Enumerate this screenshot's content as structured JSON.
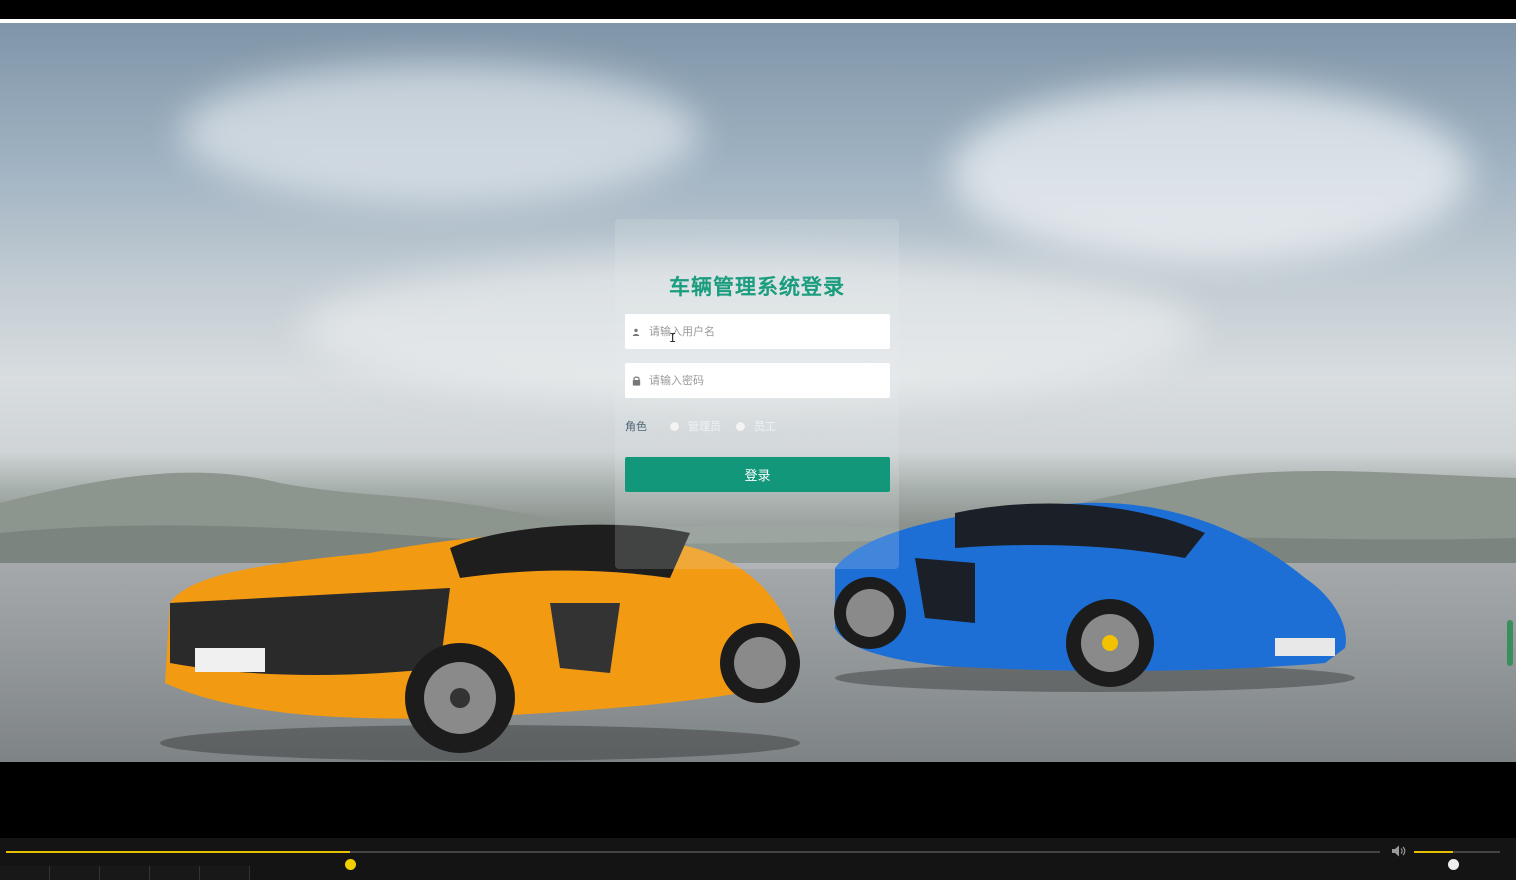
{
  "login": {
    "title": "车辆管理系统登录",
    "username_placeholder": "请输入用户名",
    "password_placeholder": "请输入密码",
    "role_label": "角色",
    "roles": [
      "管理员",
      "员工"
    ],
    "login_button": "登录"
  },
  "colors": {
    "accent": "#13977a",
    "title": "#1a9d7e",
    "player_progress": "#e4c000"
  },
  "icons": {
    "username": "user-icon",
    "password": "lock-icon",
    "volume": "volume-icon"
  },
  "player": {
    "progress_fraction": 0.25,
    "volume_fraction": 0.45
  }
}
